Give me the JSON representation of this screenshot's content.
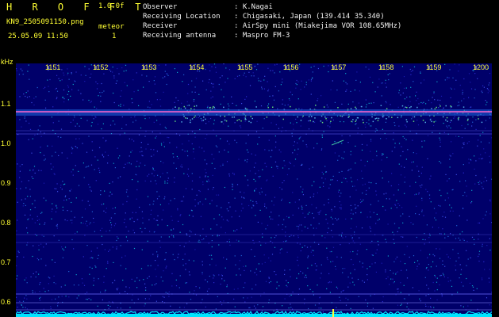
{
  "app_title": "H R O F F T",
  "version": "1.0.0f",
  "filename": "KN9_2505091150.png",
  "datetime": "25.05.09 11:50",
  "meteor_label": "meteor",
  "meteor_count": "1",
  "info": {
    "observer_label": "Observer",
    "observer_value": ": K.Nagai",
    "location_label": "Receiving Location",
    "location_value": ": Chigasaki, Japan (139.414 35.340)",
    "receiver_label": "Receiver",
    "receiver_value": ": AirSpy mini (Miakejima VOR 108.65MHz)",
    "antenna_label": "Receiving antenna",
    "antenna_value": ": Maspro FM-3"
  },
  "axis": {
    "y_unit": "kHz",
    "y_ticks": [
      "1.1",
      "1.0",
      "0.9",
      "0.8",
      "0.7",
      "0.6"
    ],
    "time_ticks": [
      "1151",
      "1152",
      "1153",
      "1154",
      "1155",
      "1156",
      "1157",
      "1158",
      "1159",
      "1200"
    ]
  },
  "colors": {
    "background": "#000000",
    "spectrogram_bg": "#00006a",
    "label_yellow": "#ffff33",
    "carrier": "#ff66cc",
    "noise_floor": "#00e5ff"
  }
}
